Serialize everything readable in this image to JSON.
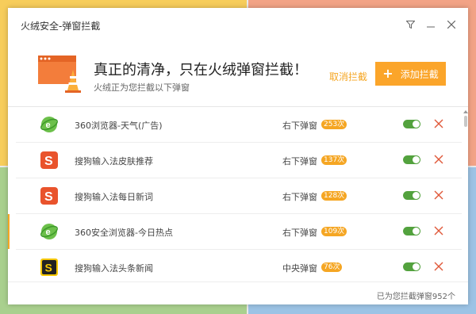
{
  "window": {
    "title": "火绒安全-弹窗拦截"
  },
  "header": {
    "headline": "真正的清净，只在火绒弹窗拦截！",
    "subline": "火绒正为您拦截以下弹窗",
    "cancel_label": "取消拦截",
    "add_label": "添加拦截",
    "add_icon": "plus-icon"
  },
  "rows": [
    {
      "name": "360浏览器-天气(广告)",
      "position": "右下弹窗",
      "count": "253次",
      "icon": "ie-green-icon",
      "enabled": true
    },
    {
      "name": "搜狗输入法皮肤推荐",
      "position": "右下弹窗",
      "count": "137次",
      "icon": "sogou-icon",
      "enabled": true
    },
    {
      "name": "搜狗输入法每日新词",
      "position": "右下弹窗",
      "count": "128次",
      "icon": "sogou-icon",
      "enabled": true
    },
    {
      "name": "360安全浏览器-今日热点",
      "position": "右下弹窗",
      "count": "109次",
      "icon": "ie-green-icon",
      "enabled": true
    },
    {
      "name": "搜狗输入法头条新闻",
      "position": "中央弹窗",
      "count": "76次",
      "icon": "sogou-black-icon",
      "enabled": true
    }
  ],
  "footer": {
    "summary": "已为您拦截弹窗952个"
  },
  "colors": {
    "accent": "#fba52a",
    "toggle_on": "#53a23e",
    "delete": "#e0593b"
  }
}
